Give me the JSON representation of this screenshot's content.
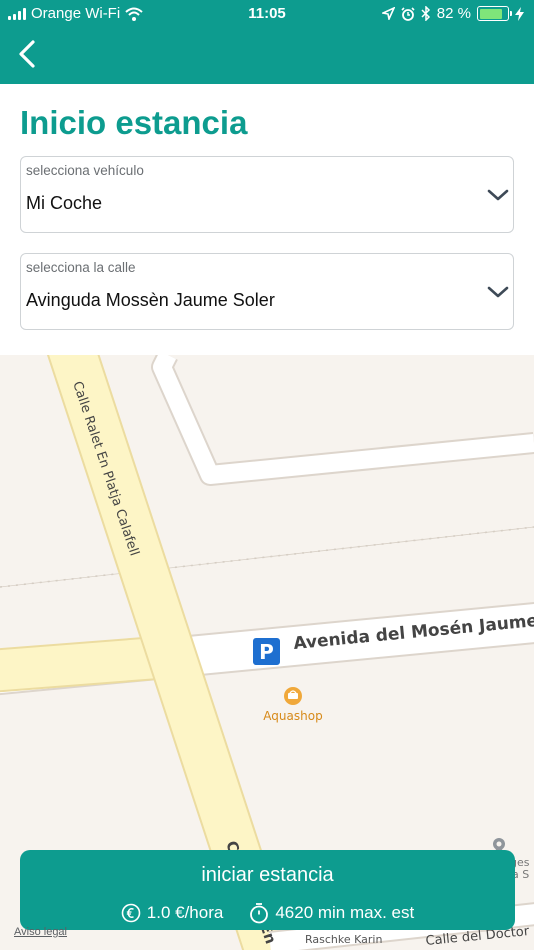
{
  "status_bar": {
    "carrier": "Orange Wi-Fi",
    "time": "11:05",
    "battery": "82 %",
    "battery_level": 0.82
  },
  "form": {
    "title": "Inicio estancia",
    "vehicle": {
      "label": "selecciona vehículo",
      "value": "Mi Coche"
    },
    "street": {
      "label": "selecciona la calle",
      "value": "Avinguda Mossèn Jaume Soler"
    }
  },
  "map": {
    "street_ralet": "Calle Ralet En Platja Calafell",
    "street_mosen": "Avenida del Mosén Jaume S",
    "poi_aquashop": "Aquashop",
    "parking_symbol": "P",
    "street_bottom_fragment": "C",
    "street_bottom_fragment_2": "En",
    "poi_right_fragment": "ges",
    "poi_right_fragment_2": "a S",
    "label_raschke": "Raschke Karin",
    "label_calle_doctor": "Calle del Doctor"
  },
  "action": {
    "main_label": "iniciar estancia",
    "price": "1.0 €/hora",
    "max_time": "4620 min max. est"
  },
  "footer": {
    "legal_link": "Aviso legal"
  },
  "colors": {
    "brand": "#0d9c8f",
    "map_bg": "#f7f3ee",
    "road_yellow": "#fdf5c6"
  },
  "icons": [
    "back-chevron-icon",
    "wifi-icon",
    "location-icon",
    "alarm-icon",
    "bluetooth-icon",
    "battery-icon",
    "chevron-down-icon",
    "parking-icon",
    "shop-icon",
    "euro-icon",
    "stopwatch-icon"
  ]
}
